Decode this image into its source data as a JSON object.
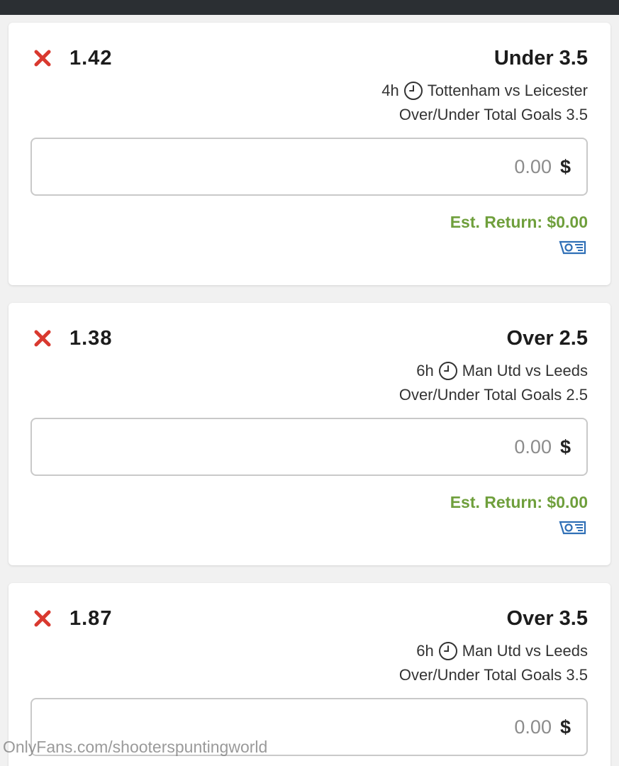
{
  "colors": {
    "top_bar": "#2b2f33",
    "remove_icon": "#d9392f",
    "est_return": "#6f9f3c",
    "cash_icon": "#2f6fb6"
  },
  "bets": [
    {
      "odds": "1.42",
      "selection": "Under 3.5",
      "time": "4h",
      "match": "Tottenham vs Leicester",
      "market": "Over/Under Total Goals 3.5",
      "stake_value": "0.00",
      "currency": "$",
      "est_return": "Est. Return: $0.00",
      "icons": [
        "close-icon",
        "clock-icon",
        "cash-icon"
      ]
    },
    {
      "odds": "1.38",
      "selection": "Over 2.5",
      "time": "6h",
      "match": "Man Utd vs Leeds",
      "market": "Over/Under Total Goals 2.5",
      "stake_value": "0.00",
      "currency": "$",
      "est_return": "Est. Return: $0.00",
      "icons": [
        "close-icon",
        "clock-icon",
        "cash-icon"
      ]
    },
    {
      "odds": "1.87",
      "selection": "Over 3.5",
      "time": "6h",
      "match": "Man Utd vs Leeds",
      "market": "Over/Under Total Goals 3.5",
      "stake_value": "0.00",
      "currency": "$",
      "icons": [
        "close-icon",
        "clock-icon"
      ]
    }
  ],
  "watermark": "OnlyFans.com/shooterspuntingworld"
}
